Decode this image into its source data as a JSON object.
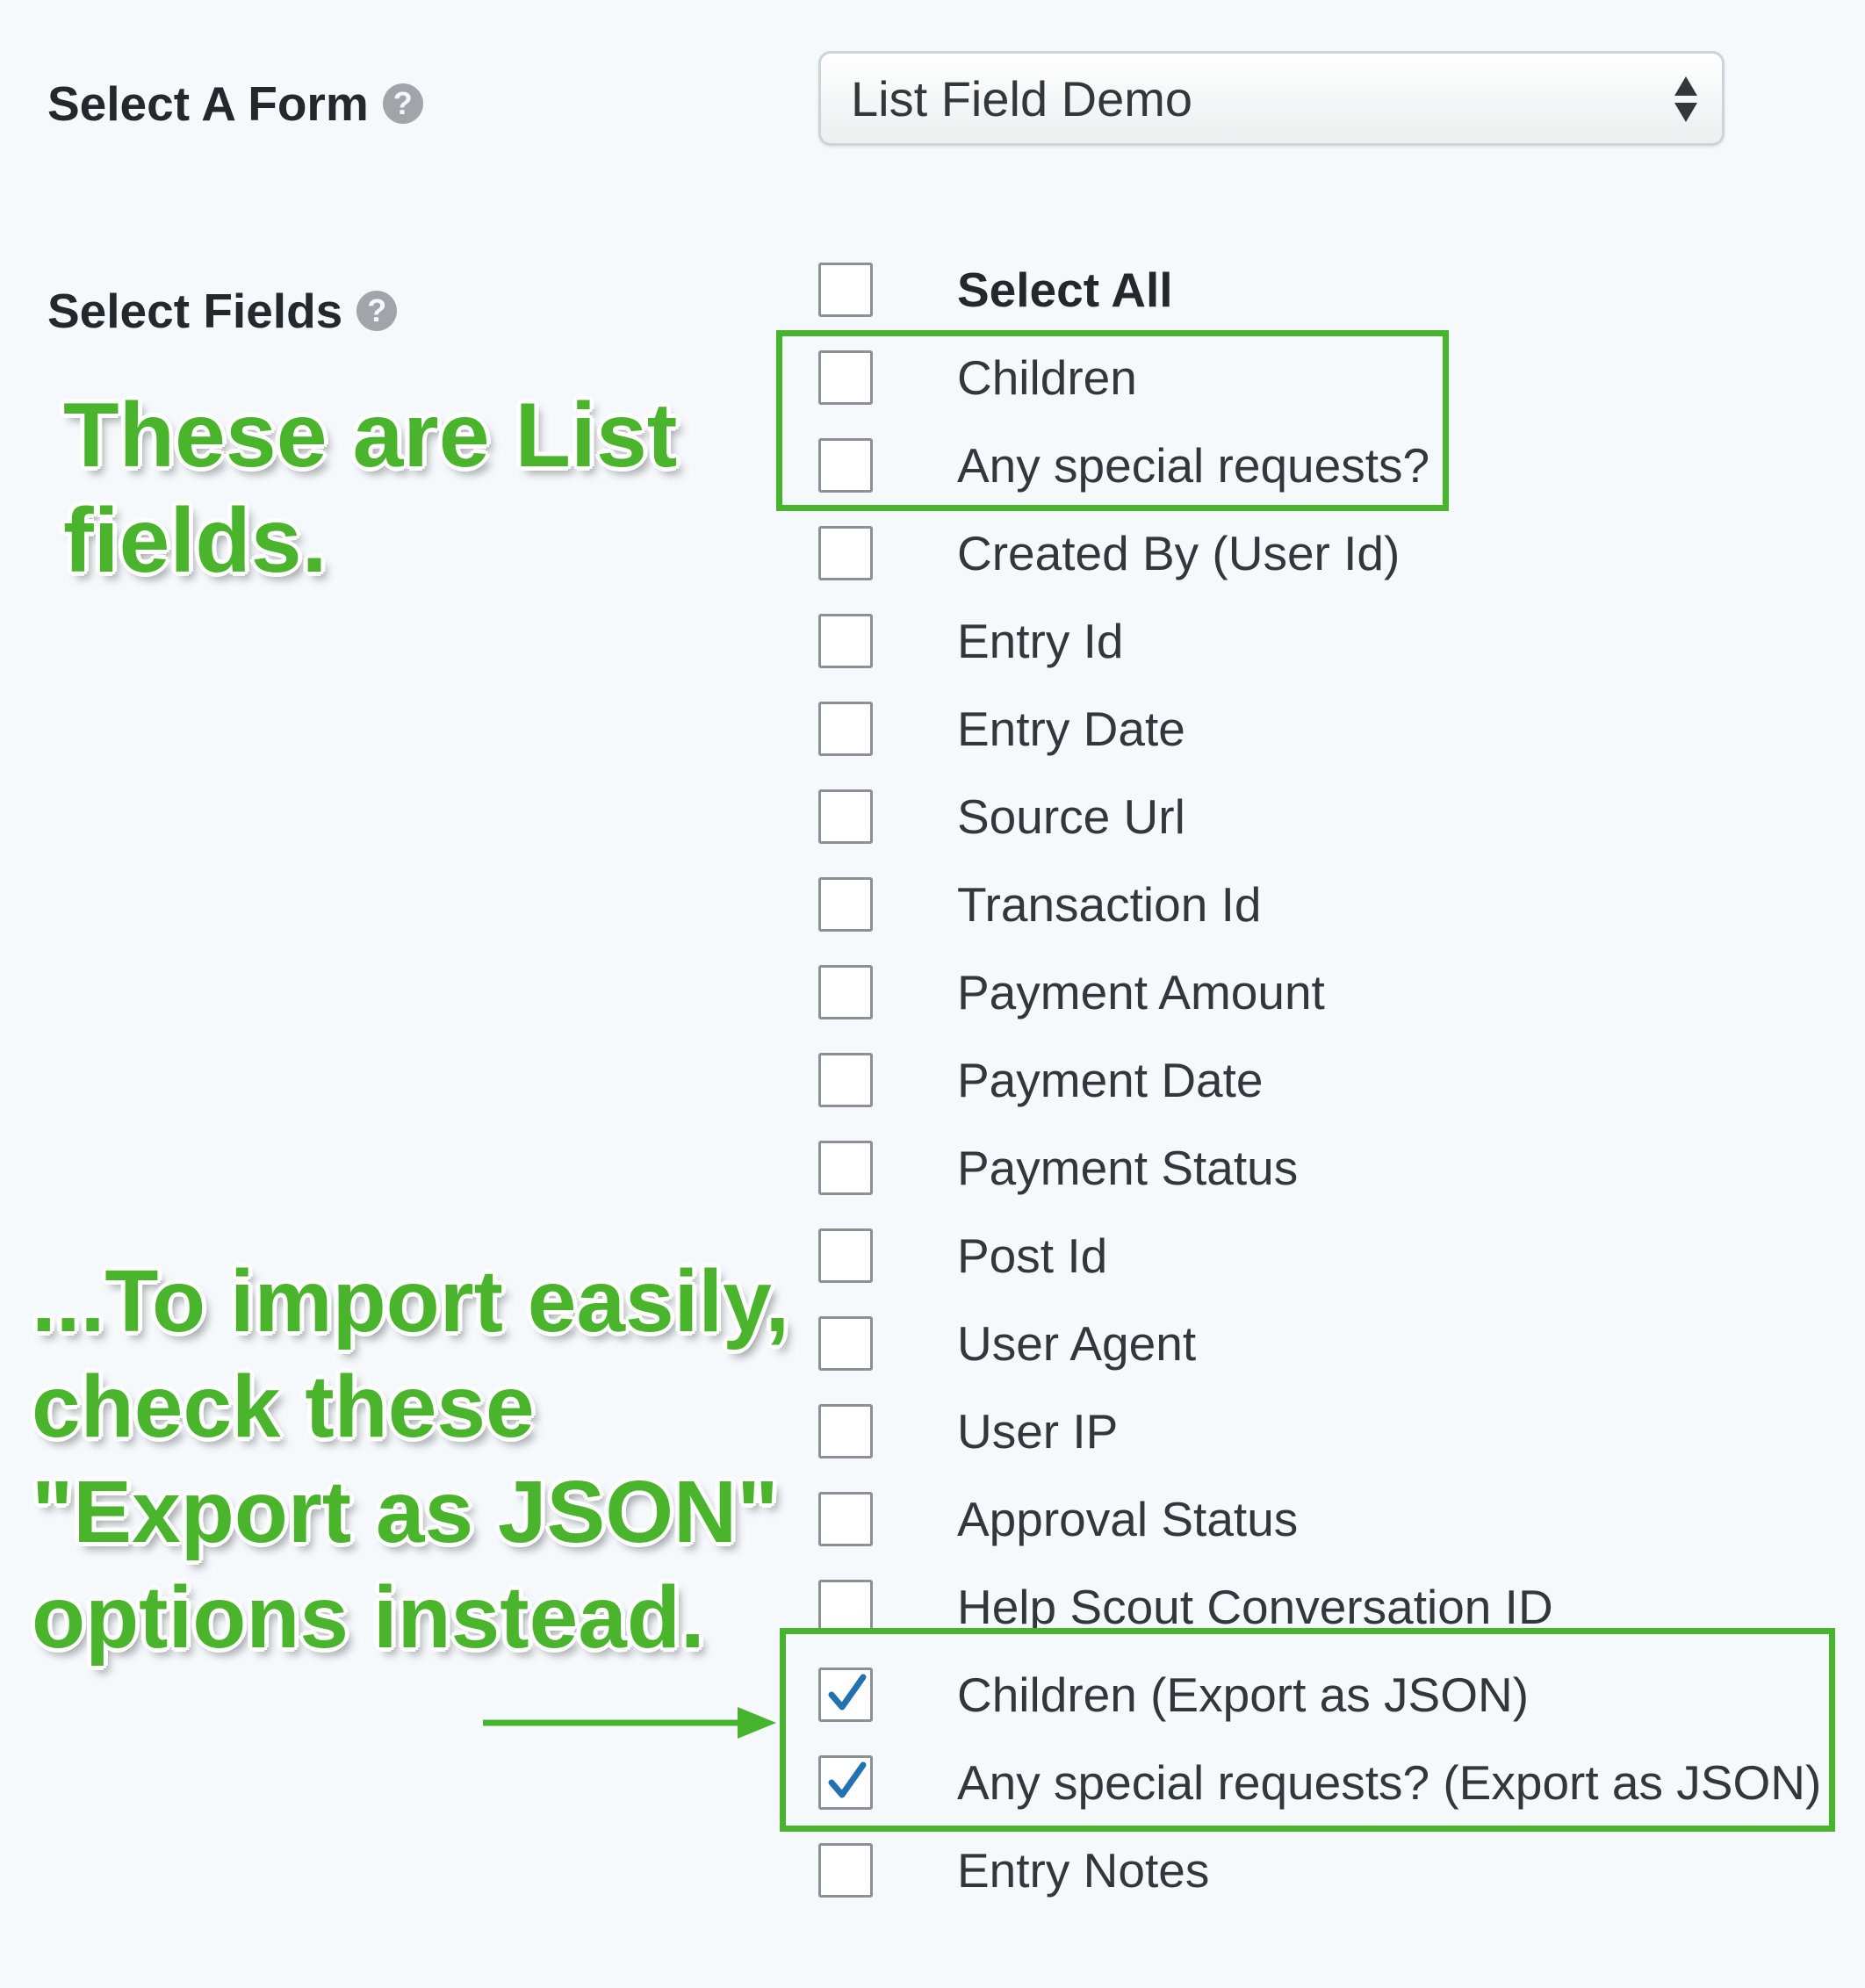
{
  "form_select": {
    "label": "Select A Form",
    "help": "?",
    "value": "List Field Demo"
  },
  "fields_section": {
    "label": "Select Fields",
    "help": "?",
    "select_all_label": "Select All",
    "fields": [
      {
        "label": "Children",
        "checked": false
      },
      {
        "label": "Any special requests?",
        "checked": false
      },
      {
        "label": "Created By (User Id)",
        "checked": false
      },
      {
        "label": "Entry Id",
        "checked": false
      },
      {
        "label": "Entry Date",
        "checked": false
      },
      {
        "label": "Source Url",
        "checked": false
      },
      {
        "label": "Transaction Id",
        "checked": false
      },
      {
        "label": "Payment Amount",
        "checked": false
      },
      {
        "label": "Payment Date",
        "checked": false
      },
      {
        "label": "Payment Status",
        "checked": false
      },
      {
        "label": "Post Id",
        "checked": false
      },
      {
        "label": "User Agent",
        "checked": false
      },
      {
        "label": "User IP",
        "checked": false
      },
      {
        "label": "Approval Status",
        "checked": false
      },
      {
        "label": "Help Scout Conversation ID",
        "checked": false
      },
      {
        "label": "Children (Export as JSON)",
        "checked": true
      },
      {
        "label": "Any special requests? (Export as JSON)",
        "checked": true
      },
      {
        "label": "Entry Notes",
        "checked": false
      }
    ]
  },
  "annotations": {
    "list_fields_note": "These are List\nfields.",
    "json_note": "...To import easily,\ncheck these\n\"Export as JSON\"\noptions instead."
  },
  "colors": {
    "annotation_green": "#4ab52c",
    "highlight_green": "#46b42c",
    "checkmark_blue": "#2271b1",
    "background": "#f5f9fc"
  }
}
